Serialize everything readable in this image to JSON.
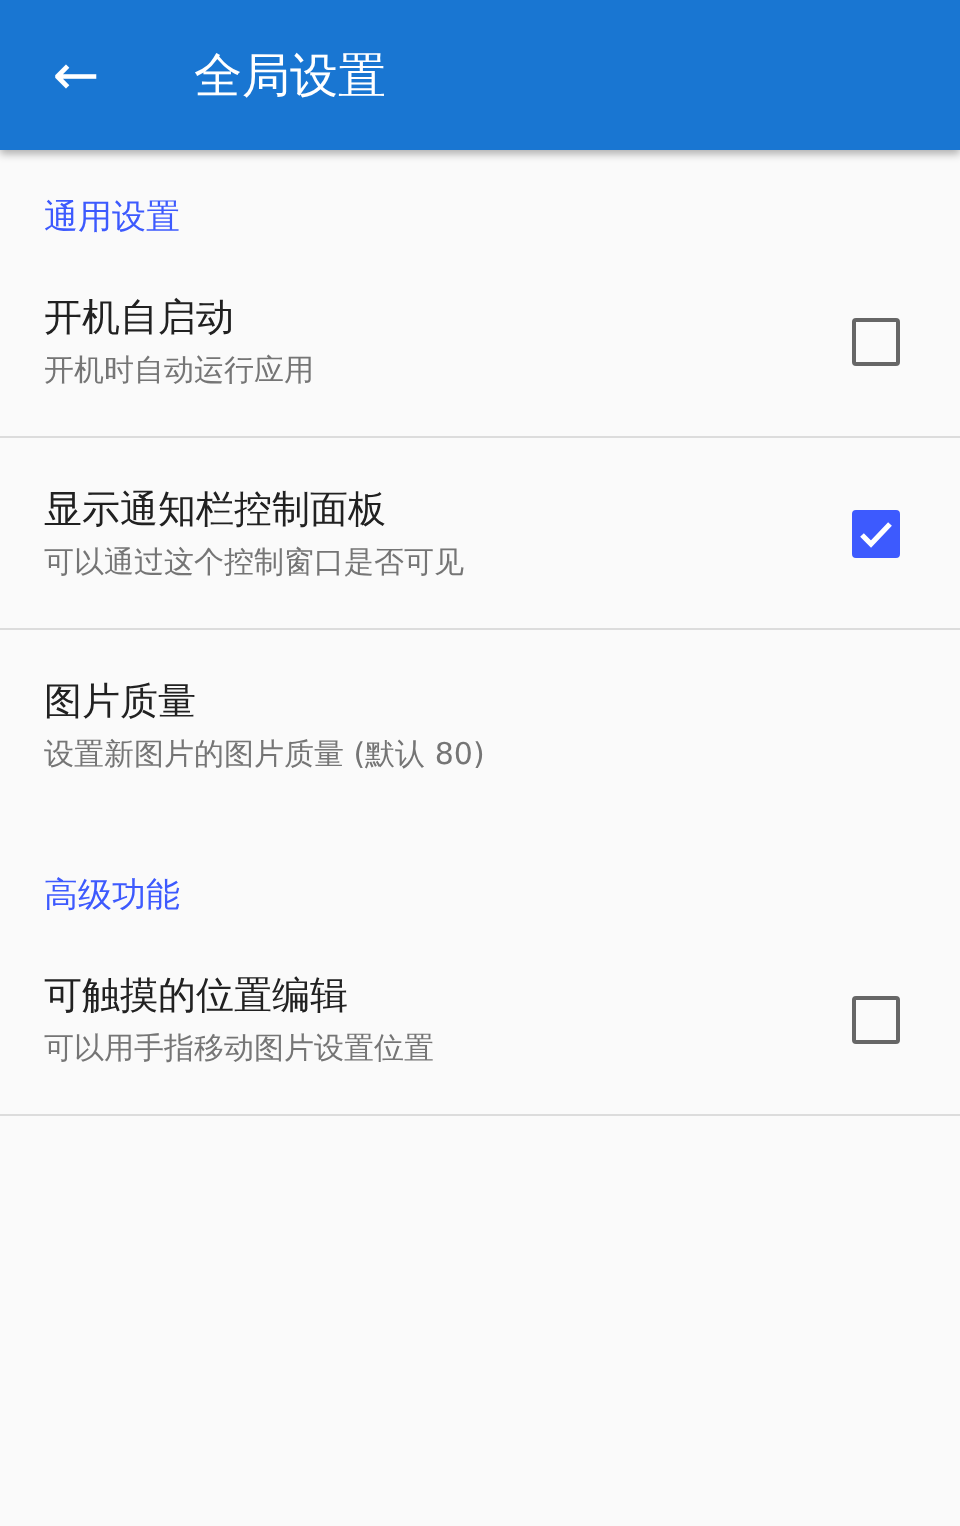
{
  "app_bar": {
    "back_icon": "←",
    "title": "全局设置"
  },
  "sections": [
    {
      "header": "通用设置",
      "items": [
        {
          "kind": "checkbox",
          "title": "开机自启动",
          "summary": "开机时自动运行应用",
          "checked": false
        },
        {
          "kind": "checkbox",
          "title": "显示通知栏控制面板",
          "summary": "可以通过这个控制窗口是否可见",
          "checked": true
        },
        {
          "kind": "plain",
          "title": "图片质量",
          "summary": "设置新图片的图片质量 (默认 80)"
        }
      ]
    },
    {
      "header": "高级功能",
      "items": [
        {
          "kind": "checkbox",
          "title": "可触摸的位置编辑",
          "summary": "可以用手指移动图片设置位置",
          "checked": false
        }
      ]
    }
  ]
}
